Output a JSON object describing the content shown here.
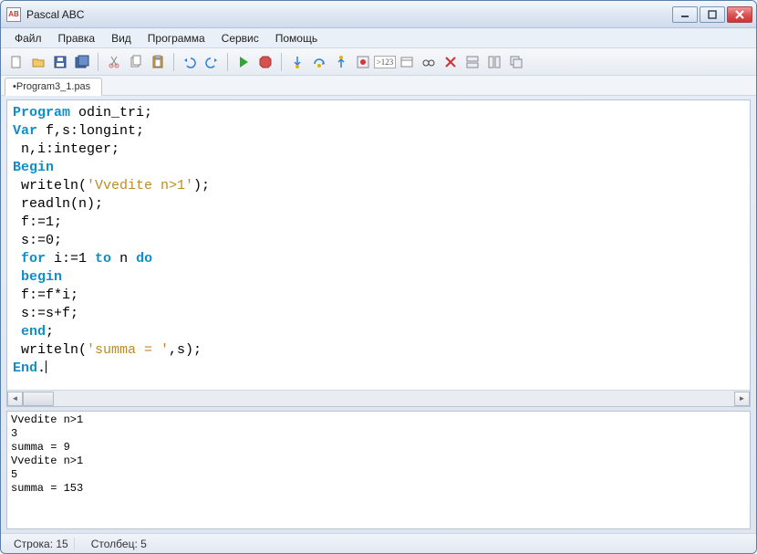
{
  "title": "Pascal ABC",
  "app_icon_text": "AB",
  "menus": [
    "Файл",
    "Правка",
    "Вид",
    "Программа",
    "Сервис",
    "Помощь"
  ],
  "toolbar": [
    {
      "n": "new-file-icon",
      "sep": false
    },
    {
      "n": "open-file-icon",
      "sep": false
    },
    {
      "n": "save-icon",
      "sep": false
    },
    {
      "n": "save-all-icon",
      "sep": false
    },
    {
      "sep": true
    },
    {
      "n": "cut-icon",
      "sep": false
    },
    {
      "n": "copy-icon",
      "sep": false
    },
    {
      "n": "paste-icon",
      "sep": false
    },
    {
      "sep": true
    },
    {
      "n": "undo-icon",
      "sep": false
    },
    {
      "n": "redo-icon",
      "sep": false
    },
    {
      "sep": true
    },
    {
      "n": "run-icon",
      "sep": false
    },
    {
      "n": "stop-icon",
      "sep": false
    },
    {
      "sep": true
    },
    {
      "n": "step-into-icon",
      "sep": false
    },
    {
      "n": "step-over-icon",
      "sep": false
    },
    {
      "n": "step-out-icon",
      "sep": false
    },
    {
      "n": "breakpoint-icon",
      "sep": false
    },
    {
      "n": "goto-line-icon",
      "label": ">123"
    },
    {
      "n": "window-icon",
      "sep": false
    },
    {
      "n": "glasses-icon",
      "sep": false
    },
    {
      "n": "close-output-icon",
      "sep": false
    },
    {
      "n": "tile-h-icon",
      "sep": false
    },
    {
      "n": "tile-v-icon",
      "sep": false
    },
    {
      "n": "cascade-icon",
      "sep": false
    }
  ],
  "tab": "•Program3_1.pas",
  "code": [
    [
      {
        "t": "Program",
        "c": "kw"
      },
      {
        "t": " odin_tri;"
      }
    ],
    [
      {
        "t": "Var",
        "c": "kw"
      },
      {
        "t": " f,s:longint;"
      }
    ],
    [
      {
        "t": " n,i:integer;"
      }
    ],
    [
      {
        "t": "Begin",
        "c": "kw"
      }
    ],
    [
      {
        "t": " writeln("
      },
      {
        "t": "'Vvedite n>1'",
        "c": "st"
      },
      {
        "t": ");"
      }
    ],
    [
      {
        "t": " readln(n);"
      }
    ],
    [
      {
        "t": " f:=1;"
      }
    ],
    [
      {
        "t": " s:=0;"
      }
    ],
    [
      {
        "t": " "
      },
      {
        "t": "for",
        "c": "kw"
      },
      {
        "t": " i:=1 "
      },
      {
        "t": "to",
        "c": "kw"
      },
      {
        "t": " n "
      },
      {
        "t": "do",
        "c": "kw"
      }
    ],
    [
      {
        "t": " "
      },
      {
        "t": "begin",
        "c": "kw"
      }
    ],
    [
      {
        "t": " f:=f*i;"
      }
    ],
    [
      {
        "t": " s:=s+f;"
      }
    ],
    [
      {
        "t": " "
      },
      {
        "t": "end",
        "c": "kw"
      },
      {
        "t": ";"
      }
    ],
    [
      {
        "t": " writeln("
      },
      {
        "t": "'summa = '",
        "c": "st"
      },
      {
        "t": ",s);"
      }
    ],
    [
      {
        "t": "End",
        "c": "kw"
      },
      {
        "t": "."
      },
      {
        "caret": true
      }
    ]
  ],
  "output": "Vvedite n>1\n3\nsumma = 9\nVvedite n>1\n5\nsumma = 153",
  "status": {
    "line_label": "Строка:",
    "line_val": "15",
    "col_label": "Столбец:",
    "col_val": "5"
  }
}
